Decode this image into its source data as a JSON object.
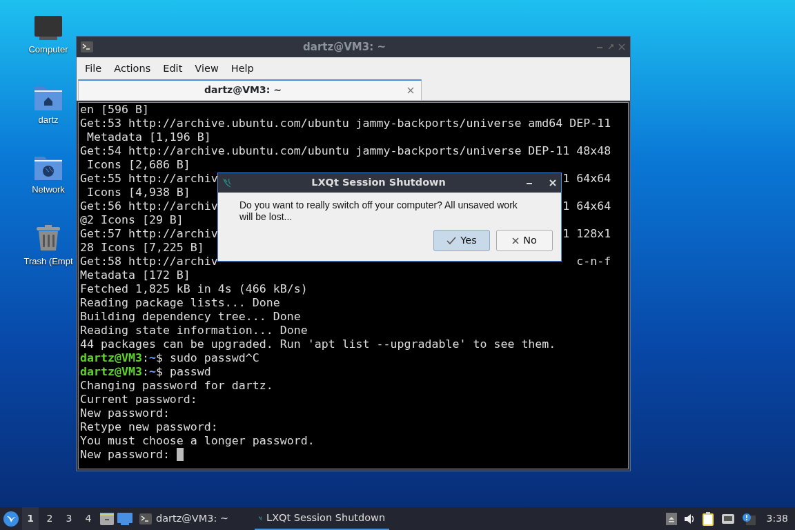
{
  "desktop_icons": [
    {
      "kind": "computer",
      "label": "Computer"
    },
    {
      "kind": "home",
      "label": "dartz"
    },
    {
      "kind": "network",
      "label": "Network"
    },
    {
      "kind": "trash",
      "label": "Trash (Empt"
    }
  ],
  "terminal": {
    "title": "dartz@VM3: ~",
    "menu": [
      "File",
      "Actions",
      "Edit",
      "View",
      "Help"
    ],
    "tabs": [
      {
        "label": "dartz@VM3: ~",
        "selected": true
      }
    ],
    "lines": [
      {
        "kind": "text",
        "text": "en [596 B]"
      },
      {
        "kind": "text",
        "text": "Get:53 http://archive.ubuntu.com/ubuntu jammy-backports/universe amd64 DEP-11"
      },
      {
        "kind": "text",
        "text": " Metadata [1,196 B]"
      },
      {
        "kind": "text",
        "text": "Get:54 http://archive.ubuntu.com/ubuntu jammy-backports/universe DEP-11 48x48"
      },
      {
        "kind": "text",
        "text": " Icons [2,686 B]"
      },
      {
        "kind": "split",
        "parts": [
          "Get:55 http://archiv",
          "1 64x64"
        ]
      },
      {
        "kind": "text",
        "text": " Icons [4,938 B]"
      },
      {
        "kind": "split",
        "parts": [
          "Get:56 http://archiv",
          "1 64x64"
        ]
      },
      {
        "kind": "text",
        "text": "@2 Icons [29 B]"
      },
      {
        "kind": "split",
        "parts": [
          "Get:57 http://archiv",
          "1 128x1"
        ]
      },
      {
        "kind": "text",
        "text": "28 Icons [7,225 B]"
      },
      {
        "kind": "split",
        "parts": [
          "Get:58 http://archiv",
          "c-n-f"
        ]
      },
      {
        "kind": "text",
        "text": "Metadata [172 B]"
      },
      {
        "kind": "text",
        "text": "Fetched 1,825 kB in 4s (466 kB/s)"
      },
      {
        "kind": "text",
        "text": "Reading package lists... Done"
      },
      {
        "kind": "text",
        "text": "Building dependency tree... Done"
      },
      {
        "kind": "text",
        "text": "Reading state information... Done"
      },
      {
        "kind": "text",
        "text": "44 packages can be upgraded. Run 'apt list --upgradable' to see them."
      },
      {
        "kind": "prompt",
        "user": "dartz@VM3",
        "sep": ":",
        "path": "~",
        "command": "$ sudo passwd^C"
      },
      {
        "kind": "prompt",
        "user": "dartz@VM3",
        "sep": ":",
        "path": "~",
        "command": "$ passwd"
      },
      {
        "kind": "text",
        "text": "Changing password for dartz."
      },
      {
        "kind": "text",
        "text": "Current password:"
      },
      {
        "kind": "text",
        "text": "New password:"
      },
      {
        "kind": "text",
        "text": "Retype new password:"
      },
      {
        "kind": "text",
        "text": "You must choose a longer password."
      },
      {
        "kind": "input",
        "text": "New password: "
      }
    ]
  },
  "dialog": {
    "title": "LXQt Session Shutdown",
    "message": "Do you want to really switch off your computer? All unsaved work will be lost...",
    "buttons": [
      {
        "kind": "yes",
        "label": "Yes",
        "selected": true
      },
      {
        "kind": "no",
        "label": "No",
        "selected": false
      }
    ]
  },
  "taskbar": {
    "desktops": [
      {
        "label": "1",
        "selected": true
      },
      {
        "label": "2",
        "selected": false
      },
      {
        "label": "3",
        "selected": false
      },
      {
        "label": "4",
        "selected": false
      }
    ],
    "tasks": [
      {
        "kind": "terminal",
        "label": "dartz@VM3: ~",
        "selected": false
      },
      {
        "kind": "dialog",
        "label": "LXQt Session Shutdown",
        "selected": true
      }
    ],
    "clock": "3:38"
  }
}
